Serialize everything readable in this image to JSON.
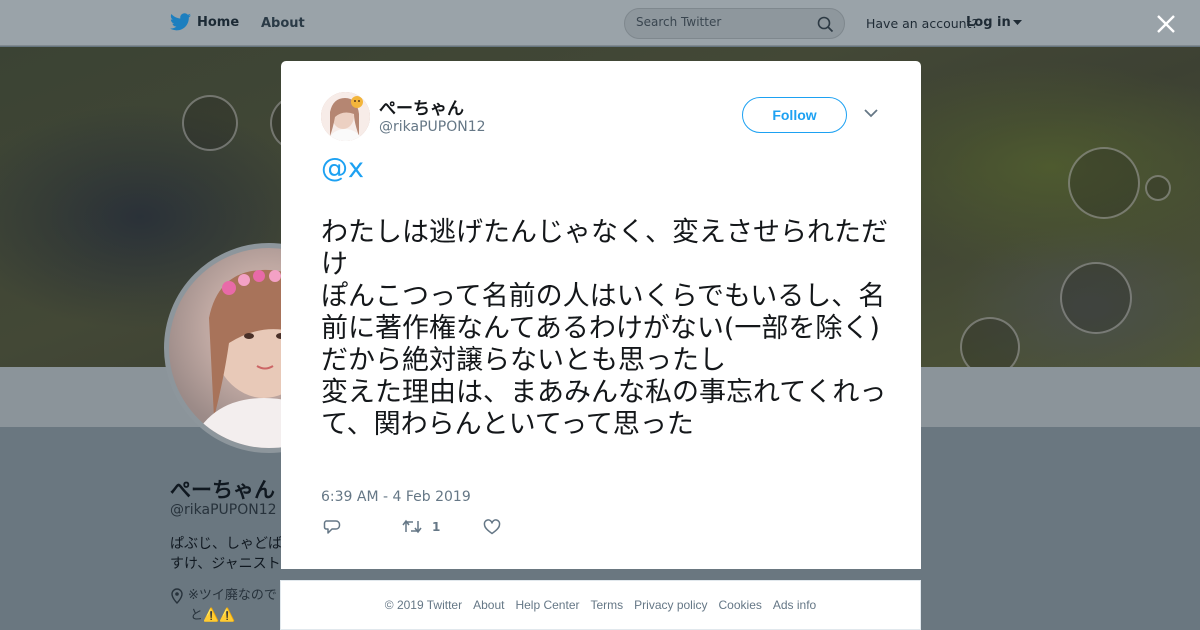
{
  "nav": {
    "home_label": "Home",
    "about_label": "About",
    "search_placeholder": "Search Twitter",
    "have_account": "Have an account?",
    "login_label": "Log in"
  },
  "profile": {
    "name": "ぺーちゃん",
    "handle": "@rikaPUPON12",
    "bio_line1": "ぱぶじ、しゃどば",
    "bio_line2": "すけ、ジャニスト",
    "location": "※ツイ廃なので",
    "location_line2": "と⚠️⚠️"
  },
  "tweet": {
    "author_name": "ぺーちゃん",
    "author_handle": "@rikaPUPON12",
    "follow_label": "Follow",
    "mention": "@x",
    "body": "\n\nわたしは逃げたんじゃなく、変えさせられただけ\nぽんこつって名前の人はいくらでもいるし、名前に著作権なんてあるわけがない(一部を除く)\nだから絶対譲らないとも思ったし\n変えた理由は、まあみんな私の事忘れてくれって、関わらんといてって思った",
    "timestamp": "6:39 AM - 4 Feb 2019",
    "retweet_count": "1"
  },
  "footer": {
    "copyright": "© 2019 Twitter",
    "links": [
      "About",
      "Help Center",
      "Terms",
      "Privacy policy",
      "Cookies",
      "Ads info"
    ]
  },
  "icons": {
    "brand": "twitter-bird-icon",
    "search": "search-icon",
    "close": "close-icon",
    "reply": "reply-icon",
    "retweet": "retweet-icon",
    "like": "heart-icon"
  },
  "colors": {
    "accent": "#1da1f2",
    "overlay": "#66757f",
    "text": "#14171a",
    "secondary": "#657786"
  }
}
